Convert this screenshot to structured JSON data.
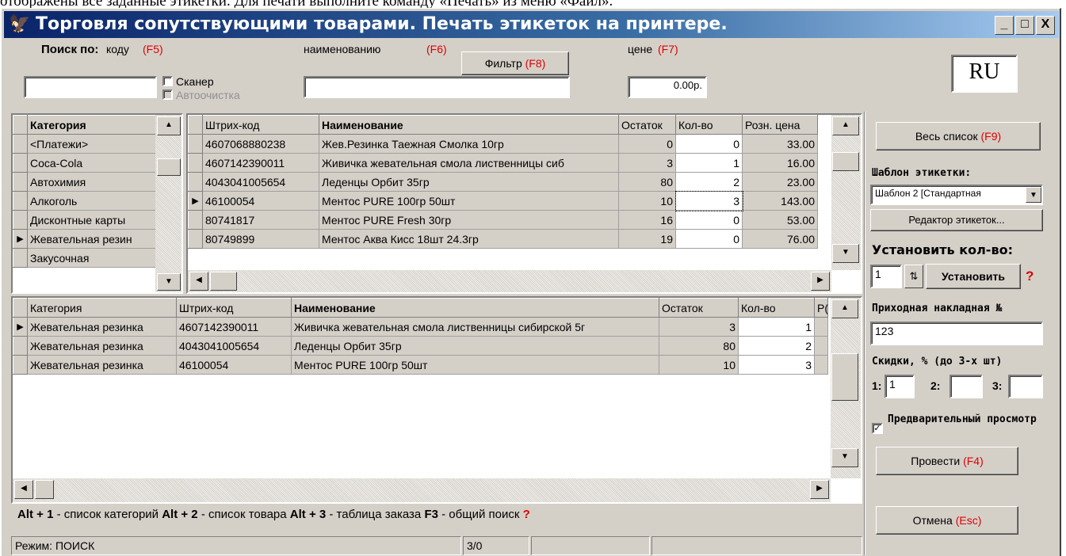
{
  "doc_line": "отображены все заданные этикетки. Для печати выполните команду «Печать» из меню «Файл».",
  "title": "Торговля сопутствующими товарами. Печать этикеток на принтере.",
  "caption_buttons": {
    "min": "_",
    "max": "□",
    "close": "X"
  },
  "search": {
    "label": "Поиск по:",
    "by_code": "коду",
    "code_key": "(F5)",
    "scanner": "Сканер",
    "autoclear": "Автоочистка",
    "by_name": "наименованию",
    "name_key": "(F6)",
    "filter": "Фильтр",
    "filter_key": "(F8)",
    "by_price": "цене",
    "price_key": "(F7)",
    "price_value": "0.00р.",
    "code_value": "",
    "name_value": ""
  },
  "lang": "RU",
  "categories": {
    "header": "Категория",
    "items": [
      "<Платежи>",
      "Coca-Cola",
      "Автохимия",
      "Алкоголь",
      "Дисконтные карты",
      "Жевательная резин",
      "Закусочная"
    ]
  },
  "products": {
    "headers": [
      "Штрих-код",
      "Наименование",
      "Остаток",
      "Кол-во",
      "Розн. цена"
    ],
    "rows": [
      [
        "4607068880238",
        "Жев.Резинка Таежная Смолка 10гр",
        "0",
        "0",
        "33.00"
      ],
      [
        "4607142390011",
        "Живичка жевательная смола лиственницы сиб",
        "3",
        "1",
        "16.00"
      ],
      [
        "4043041005654",
        "Леденцы Орбит 35гр",
        "80",
        "2",
        "23.00"
      ],
      [
        "46100054",
        "Ментос PURE 100гр 50шт",
        "10",
        "3",
        "143.00"
      ],
      [
        "80741817",
        "Ментос PURE Fresh 30гр",
        "16",
        "0",
        "53.00"
      ],
      [
        "80749899",
        "Ментос Аква Кисс 18шт 24.3гр",
        "19",
        "0",
        "76.00"
      ]
    ]
  },
  "order": {
    "headers": [
      "Категория",
      "Штрих-код",
      "Наименование",
      "Остаток",
      "Кол-во",
      "Р("
    ],
    "rows": [
      [
        "Жевательная резинка",
        "4607142390011",
        "Живичка жевательная смола лиственницы сибирской 5г",
        "3",
        "1"
      ],
      [
        "Жевательная резинка",
        "4043041005654",
        "Леденцы Орбит 35гр",
        "80",
        "2"
      ],
      [
        "Жевательная резинка",
        "46100054",
        "Ментос PURE 100гр 50шт",
        "10",
        "3"
      ]
    ]
  },
  "right": {
    "all_list": "Весь список",
    "all_list_key": "(F9)",
    "template_label": "Шаблон этикетки:",
    "template_value": "Шаблон 2 [Стандартная",
    "editor": "Редактор этикеток...",
    "set_qty_label": "Установить кол-во:",
    "qty_value": "1",
    "set_btn": "Установить",
    "invoice_label": "Приходная накладная №",
    "invoice_value": "123",
    "discount_label": "Скидки, % (до 3-х шт)",
    "d1": "1:",
    "d1v": "1",
    "d2": "2:",
    "d2v": "",
    "d3": "3:",
    "d3v": "",
    "preview": "Предварительный просмотр",
    "post": "Провести",
    "post_key": "(F4)",
    "cancel": "Отмена",
    "cancel_key": "(Esc)",
    "help": "?"
  },
  "hints": {
    "k1": "Alt + 1",
    "t1": "- список категорий",
    "k2": "Alt + 2",
    "t2": "- список товара",
    "k3": "Alt + 3",
    "t3": "- таблица заказа",
    "k4": "F3",
    "t4": "- общий поиск",
    "q": "?"
  },
  "status": {
    "mode": "Режим: ПОИСК",
    "count": "3/0"
  }
}
